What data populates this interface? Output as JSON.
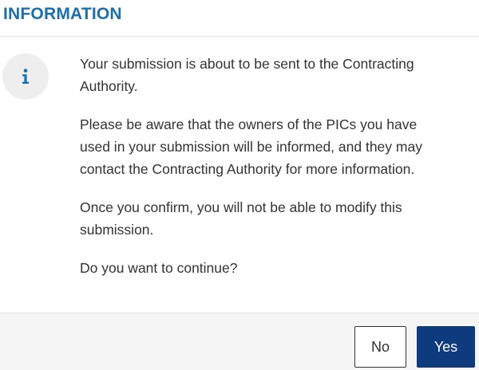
{
  "dialog": {
    "title": "INFORMATION",
    "icon": "info-icon",
    "paragraphs": [
      "Your submission is about to be sent to the Contracting Authority.",
      "Please be aware that the owners of the PICs you have used in your submission will be informed, and they may contact the Contracting Authority for more information.",
      "Once you confirm, you will not be able to modify this submission.",
      "Do you want to continue?"
    ],
    "buttons": {
      "no_label": "No",
      "yes_label": "Yes"
    }
  },
  "colors": {
    "title": "#1a6fb0",
    "icon": "#1a6fb0",
    "primary_button": "#0e3a7e",
    "footer_background": "#f5f5f5"
  }
}
